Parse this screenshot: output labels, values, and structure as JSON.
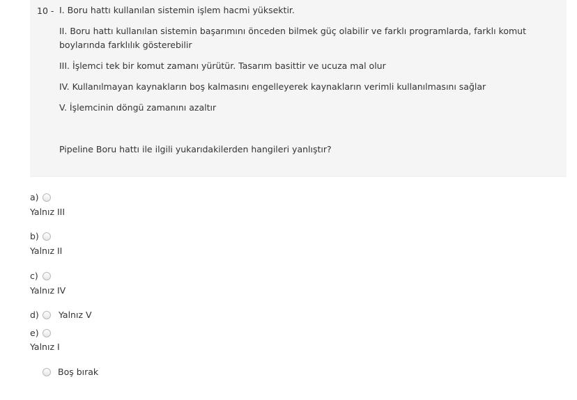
{
  "question": {
    "number": "10 -",
    "statements": [
      "I. Boru hattı kullanılan sistemin işlem hacmi yüksektir.",
      "II. Boru hattı kullanılan sistemin başarımını önceden bilmek güç olabilir ve farklı programlarda, farklı komut boylarında farklılık gösterebilir",
      "III. İşlemci tek bir komut zamanı yürütür. Tasarım basittir ve ucuza mal olur",
      "IV. Kullanılmayan kaynakların boş kalmasını engelleyerek kaynakların verimli kullanılmasını sağlar",
      "V. İşlemcinin döngü zamanını azaltır"
    ],
    "prompt": "Pipeline Boru hattı ile ilgili yukarıdakilerden hangileri yanlıştır?"
  },
  "options": [
    {
      "letter": "a)",
      "text": "Yalnız III"
    },
    {
      "letter": "b)",
      "text": "Yalnız II"
    },
    {
      "letter": "c)",
      "text": "Yalnız IV"
    },
    {
      "letter": "d)",
      "text": "Yalnız V"
    },
    {
      "letter": "e)",
      "text": "Yalnız I"
    }
  ],
  "skip_label": "Boş bırak"
}
